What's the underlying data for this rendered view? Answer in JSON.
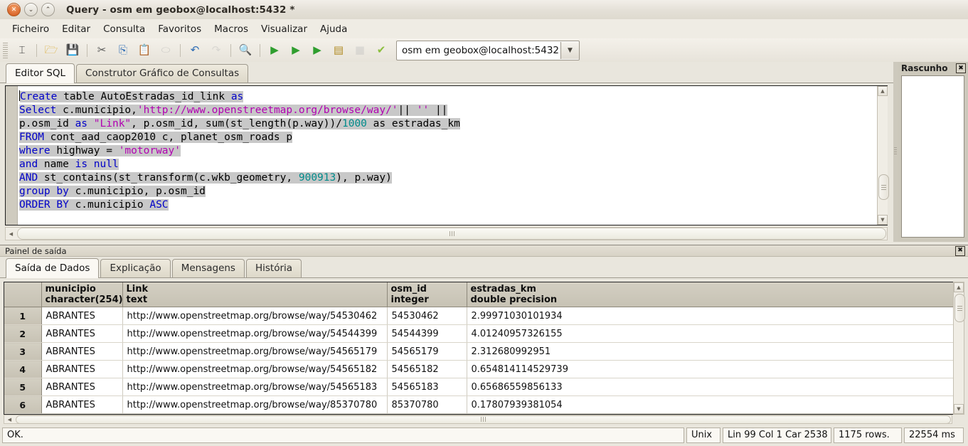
{
  "window": {
    "title": "Query - osm em geobox@localhost:5432 *",
    "buttons": [
      {
        "name": "close",
        "glyph": "✕"
      },
      {
        "name": "minimize",
        "glyph": "⌄"
      },
      {
        "name": "maximize",
        "glyph": "⌃"
      }
    ]
  },
  "menu": {
    "items": [
      "Ficheiro",
      "Editar",
      "Consulta",
      "Favoritos",
      "Macros",
      "Visualizar",
      "Ajuda"
    ]
  },
  "toolbar": {
    "buttons": [
      {
        "name": "new-query-icon",
        "glyph": "⌶",
        "color": "#3a3a3a",
        "disabled": false
      },
      {
        "name": "open-file-icon",
        "glyph": "🗁",
        "color": "#d9a41f",
        "disabled": false
      },
      {
        "name": "save-file-icon",
        "glyph": "💾",
        "color": "#2f6db5",
        "disabled": false
      },
      {
        "name": "cut-icon",
        "glyph": "✂",
        "color": "#5a5a5a",
        "disabled": false
      },
      {
        "name": "copy-icon",
        "glyph": "⎘",
        "color": "#2f6db5",
        "disabled": false
      },
      {
        "name": "paste-icon",
        "glyph": "📋",
        "color": "#c08b1e",
        "disabled": false
      },
      {
        "name": "edit-icon",
        "glyph": "⬭",
        "color": "#9a9a9a",
        "disabled": true
      },
      {
        "name": "undo-icon",
        "glyph": "↶",
        "color": "#2f6db5",
        "disabled": false
      },
      {
        "name": "redo-icon",
        "glyph": "↷",
        "color": "#b6b6b6",
        "disabled": true
      },
      {
        "name": "find-icon",
        "glyph": "🔍",
        "color": "#6a5c2a",
        "disabled": false
      },
      {
        "name": "execute-query-icon",
        "glyph": "▶",
        "color": "#2f9e2f",
        "disabled": false
      },
      {
        "name": "execute-to-file-icon",
        "glyph": "▶",
        "color": "#2f9e2f",
        "disabled": false
      },
      {
        "name": "explain-query-icon",
        "glyph": "▶",
        "color": "#2f9e2f",
        "disabled": false
      },
      {
        "name": "explain-analyze-icon",
        "glyph": "▤",
        "color": "#b08a22",
        "disabled": false
      },
      {
        "name": "stop-query-icon",
        "glyph": "■",
        "color": "#bdbdbd",
        "disabled": true
      },
      {
        "name": "query-favourites-icon",
        "glyph": "✔",
        "color": "#8cbf3f",
        "disabled": false
      }
    ],
    "connection": {
      "value": "osm em geobox@localhost:5432",
      "dropdown_glyph": "▼"
    }
  },
  "editor": {
    "tabs": [
      {
        "label": "Editor SQL",
        "active": true
      },
      {
        "label": "Construtor Gráfico de Consultas",
        "active": false
      }
    ],
    "sql_lines": [
      [
        {
          "t": "Create",
          "c": "kw"
        },
        {
          "t": " table AutoEstradas_id_link ",
          "c": "pl"
        },
        {
          "t": "as",
          "c": "kw"
        }
      ],
      [
        {
          "t": "Select",
          "c": "kw"
        },
        {
          "t": " c.municipio,",
          "c": "pl"
        },
        {
          "t": "'http://www.openstreetmap.org/browse/way/'",
          "c": "str"
        },
        {
          "t": "|| ",
          "c": "pl"
        },
        {
          "t": "''",
          "c": "str"
        },
        {
          "t": " ||",
          "c": "pl"
        }
      ],
      [
        {
          "t": "p.osm_id ",
          "c": "pl"
        },
        {
          "t": "as",
          "c": "kw"
        },
        {
          "t": " ",
          "c": "pl"
        },
        {
          "t": "\"Link\"",
          "c": "str"
        },
        {
          "t": ", p.osm_id, sum(st_length(p.way))/",
          "c": "pl"
        },
        {
          "t": "1000",
          "c": "num"
        },
        {
          "t": " as estradas_km",
          "c": "pl"
        }
      ],
      [
        {
          "t": "FROM",
          "c": "kw"
        },
        {
          "t": " cont_aad_caop2010 c, planet_osm_roads p",
          "c": "pl"
        }
      ],
      [
        {
          "t": "where",
          "c": "kw"
        },
        {
          "t": " highway = ",
          "c": "pl"
        },
        {
          "t": "'motorway'",
          "c": "str"
        }
      ],
      [
        {
          "t": "and",
          "c": "kw"
        },
        {
          "t": " name ",
          "c": "pl"
        },
        {
          "t": "is",
          "c": "kw"
        },
        {
          "t": " ",
          "c": "pl"
        },
        {
          "t": "null",
          "c": "kw"
        }
      ],
      [
        {
          "t": "AND",
          "c": "kw"
        },
        {
          "t": " st_contains(st_transform(c.wkb_geometry, ",
          "c": "pl"
        },
        {
          "t": "900913",
          "c": "num"
        },
        {
          "t": "), p.way)",
          "c": "pl"
        }
      ],
      [
        {
          "t": "group",
          "c": "kw"
        },
        {
          "t": " ",
          "c": "pl"
        },
        {
          "t": "by",
          "c": "kw"
        },
        {
          "t": " c.municipio, p.osm_id",
          "c": "pl"
        }
      ],
      [
        {
          "t": "ORDER BY",
          "c": "kw"
        },
        {
          "t": " c.municipio ",
          "c": "pl"
        },
        {
          "t": "ASC",
          "c": "kw"
        }
      ]
    ]
  },
  "scratch_dock": {
    "title": "Rascunho",
    "close_glyph": "✖"
  },
  "output": {
    "panel_title": "Painel de saída",
    "close_glyph": "✖",
    "tabs": [
      {
        "label": "Saída de Dados",
        "active": true
      },
      {
        "label": "Explicação",
        "active": false
      },
      {
        "label": "Mensagens",
        "active": false
      },
      {
        "label": "História",
        "active": false
      }
    ],
    "grid": {
      "columns": [
        {
          "name": "",
          "type": ""
        },
        {
          "name": "municipio",
          "type": "character(254)"
        },
        {
          "name": "Link",
          "type": "text"
        },
        {
          "name": "osm_id",
          "type": "integer"
        },
        {
          "name": "estradas_km",
          "type": "double precision"
        }
      ],
      "rows": [
        [
          "1",
          "ABRANTES",
          "http://www.openstreetmap.org/browse/way/54530462",
          "54530462",
          "2.99971030101934"
        ],
        [
          "2",
          "ABRANTES",
          "http://www.openstreetmap.org/browse/way/54544399",
          "54544399",
          "4.01240957326155"
        ],
        [
          "3",
          "ABRANTES",
          "http://www.openstreetmap.org/browse/way/54565179",
          "54565179",
          "2.312680992951"
        ],
        [
          "4",
          "ABRANTES",
          "http://www.openstreetmap.org/browse/way/54565182",
          "54565182",
          "0.654814114529739"
        ],
        [
          "5",
          "ABRANTES",
          "http://www.openstreetmap.org/browse/way/54565183",
          "54565183",
          "0.65686559856133"
        ],
        [
          "6",
          "ABRANTES",
          "http://www.openstreetmap.org/browse/way/85370780",
          "85370780",
          "0.17807939381054"
        ]
      ]
    }
  },
  "status": {
    "message": "OK.",
    "line_ending": "Unix",
    "position": "Lin 99 Col 1 Car 2538",
    "rows": "1175 rows.",
    "duration": "22554 ms"
  }
}
